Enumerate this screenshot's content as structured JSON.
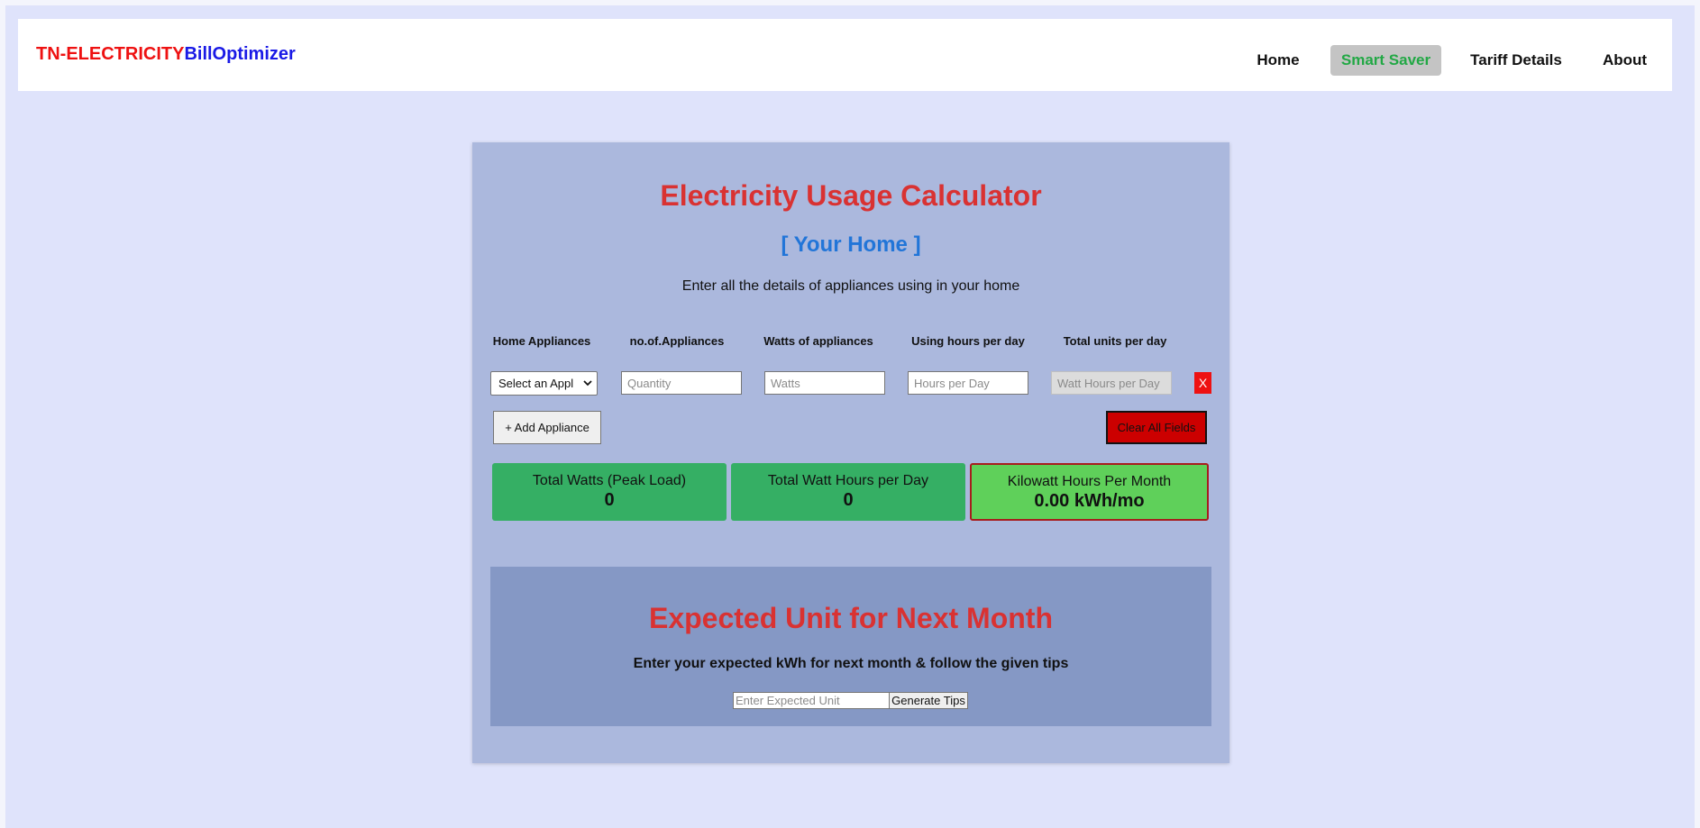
{
  "header": {
    "brand_part1": "TN-ELECTRICITY",
    "brand_part2": "BillOptimizer",
    "nav": [
      {
        "label": "Home",
        "active": false
      },
      {
        "label": "Smart Saver",
        "active": true
      },
      {
        "label": "Tariff Details",
        "active": false
      },
      {
        "label": "About",
        "active": false
      }
    ]
  },
  "calculator": {
    "title": "Electricity Usage Calculator",
    "subtitle": "[ Your Home ]",
    "intro": "Enter all the details of appliances using in your home",
    "columns": [
      "Home Appliances",
      "no.of.Appliances",
      "Watts of appliances",
      "Using hours per day",
      "Total units per day"
    ],
    "row": {
      "appliance_select": "Select an Appl",
      "quantity_placeholder": "Quantity",
      "watts_placeholder": "Watts",
      "hours_placeholder": "Hours per Day",
      "total_placeholder": "Watt Hours per Day",
      "remove_label": "X"
    },
    "add_label": "+ Add Appliance",
    "clear_label": "Clear All Fields",
    "stats": {
      "total_watts_label": "Total Watts (Peak Load)",
      "total_watts_value": "0",
      "watt_hours_label": "Total Watt Hours per Day",
      "watt_hours_value": "0",
      "kwh_month_label": "Kilowatt Hours Per Month",
      "kwh_month_value": "0.00 kWh/mo"
    }
  },
  "expected": {
    "title": "Expected Unit for Next Month",
    "text": "Enter your expected kWh for next month & follow the given tips",
    "input_placeholder": "Enter Expected Unit",
    "button_label": "Generate Tips"
  },
  "colors": {
    "page_bg": "#dfe3fb",
    "card_bg": "#abb8dd",
    "section_bg": "#8598c5",
    "title_red": "#d93232",
    "subtitle_blue": "#2175d8",
    "stat_green": "#35af64",
    "stat_light_green": "#5fd05a",
    "clear_red": "#cc0000"
  }
}
